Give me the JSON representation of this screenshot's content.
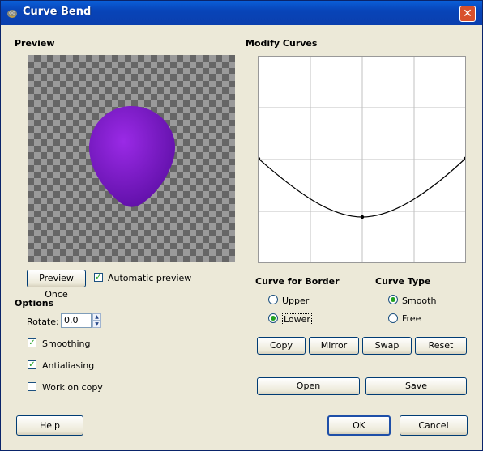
{
  "window": {
    "title": "Curve Bend",
    "close_label": "✕"
  },
  "preview": {
    "heading": "Preview",
    "preview_once_label": "Preview Once",
    "auto_preview_label": "Automatic preview",
    "auto_preview_checked": true,
    "shape_color": "#8a1fd6"
  },
  "options": {
    "heading": "Options",
    "rotate_label": "Rotate:",
    "rotate_value": "0.0",
    "smoothing_label": "Smoothing",
    "smoothing_checked": true,
    "antialiasing_label": "Antialiasing",
    "antialiasing_checked": true,
    "work_on_copy_label": "Work on copy",
    "work_on_copy_checked": false
  },
  "curves": {
    "heading": "Modify Curves",
    "border_heading": "Curve for Border",
    "upper_label": "Upper",
    "lower_label": "Lower",
    "selected_border": "lower",
    "type_heading": "Curve Type",
    "smooth_label": "Smooth",
    "free_label": "Free",
    "selected_type": "smooth",
    "copy_label": "Copy",
    "mirror_label": "Mirror",
    "swap_label": "Swap",
    "reset_label": "Reset",
    "open_label": "Open",
    "save_label": "Save"
  },
  "footer": {
    "help_label": "Help",
    "ok_label": "OK",
    "cancel_label": "Cancel"
  }
}
